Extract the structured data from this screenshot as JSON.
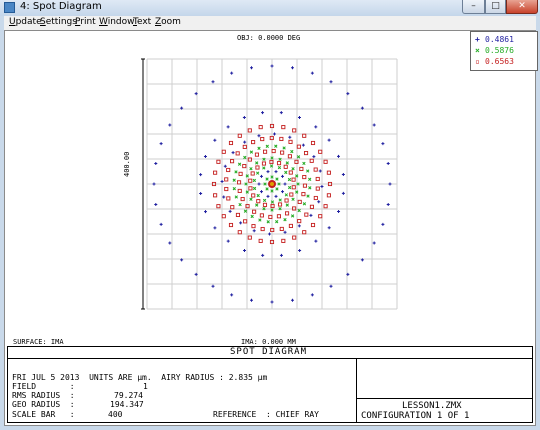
{
  "window": {
    "title": "4: Spot Diagram",
    "minimize": "–",
    "maximize": "□",
    "close": "✕"
  },
  "menu": [
    {
      "label": "Update",
      "key": "U"
    },
    {
      "label": "Settings",
      "key": "S"
    },
    {
      "label": "Print",
      "key": "P"
    },
    {
      "label": "Window",
      "key": "W"
    },
    {
      "label": "Text",
      "key": "T"
    },
    {
      "label": "Zoom",
      "key": "Z"
    }
  ],
  "plot": {
    "obj_label": "OBJ: 0.0000 DEG",
    "ima_label": "IMA: 0.000 MM",
    "scale_label": "400.00",
    "surface": "SURFACE: IMA"
  },
  "legend": [
    {
      "label": "0.4861",
      "color": "#1f1fa0",
      "marker": "plus"
    },
    {
      "label": "0.5876",
      "color": "#22aa22",
      "marker": "cross"
    },
    {
      "label": "0.6563",
      "color": "#c41e1e",
      "marker": "square"
    }
  ],
  "footer": {
    "heading": "SPOT DIAGRAM",
    "line1": "FRI JUL 5 2013  UNITS ARE µm.  AIRY RADIUS : 2.835 µm",
    "field_label": "FIELD       :",
    "field_value": "1",
    "rms_label": "RMS RADIUS  :",
    "rms_value": "79.274",
    "geo_label": "GEO RADIUS  :",
    "geo_value": "194.347",
    "scale_bar_label": "SCALE BAR   :",
    "scale_bar_value": "400",
    "reference": "REFERENCE  : CHIEF RAY",
    "file": "LESSON1.ZMX",
    "configuration": "CONFIGURATION 1 OF 1"
  }
}
